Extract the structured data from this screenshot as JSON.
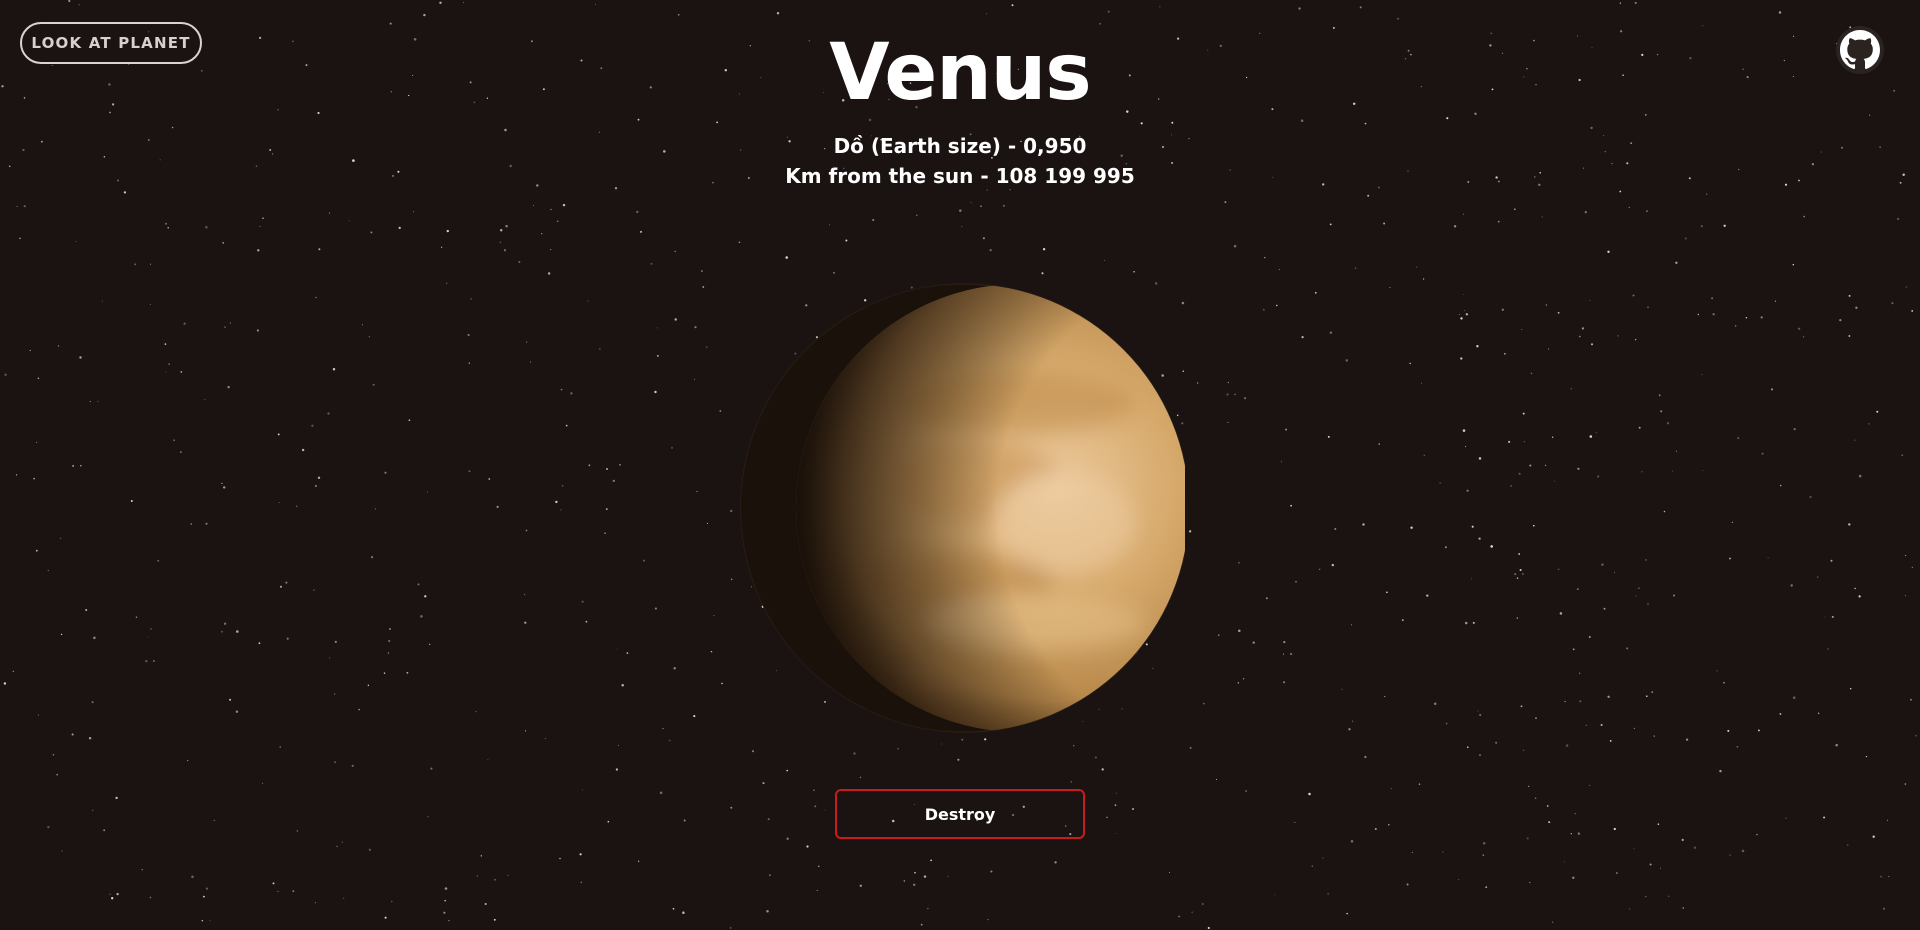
{
  "header": {
    "look_button_label": "LOOK AT PLANET",
    "github_icon": "github-icon"
  },
  "planet": {
    "name": "Venus",
    "size_line": "Dồ (Earth size) - 0,950",
    "distance_line": "Km from the sun - 108 199 995",
    "colors": {
      "surface_light": "#e8c79a",
      "surface_mid": "#c99a5e",
      "surface_dark": "#8a6232",
      "shadow": "#1c120b"
    }
  },
  "actions": {
    "destroy_label": "Destroy",
    "destroy_border_color": "#c81c1c"
  },
  "theme": {
    "background": "#1b1312",
    "star_color": "#ffffff"
  }
}
